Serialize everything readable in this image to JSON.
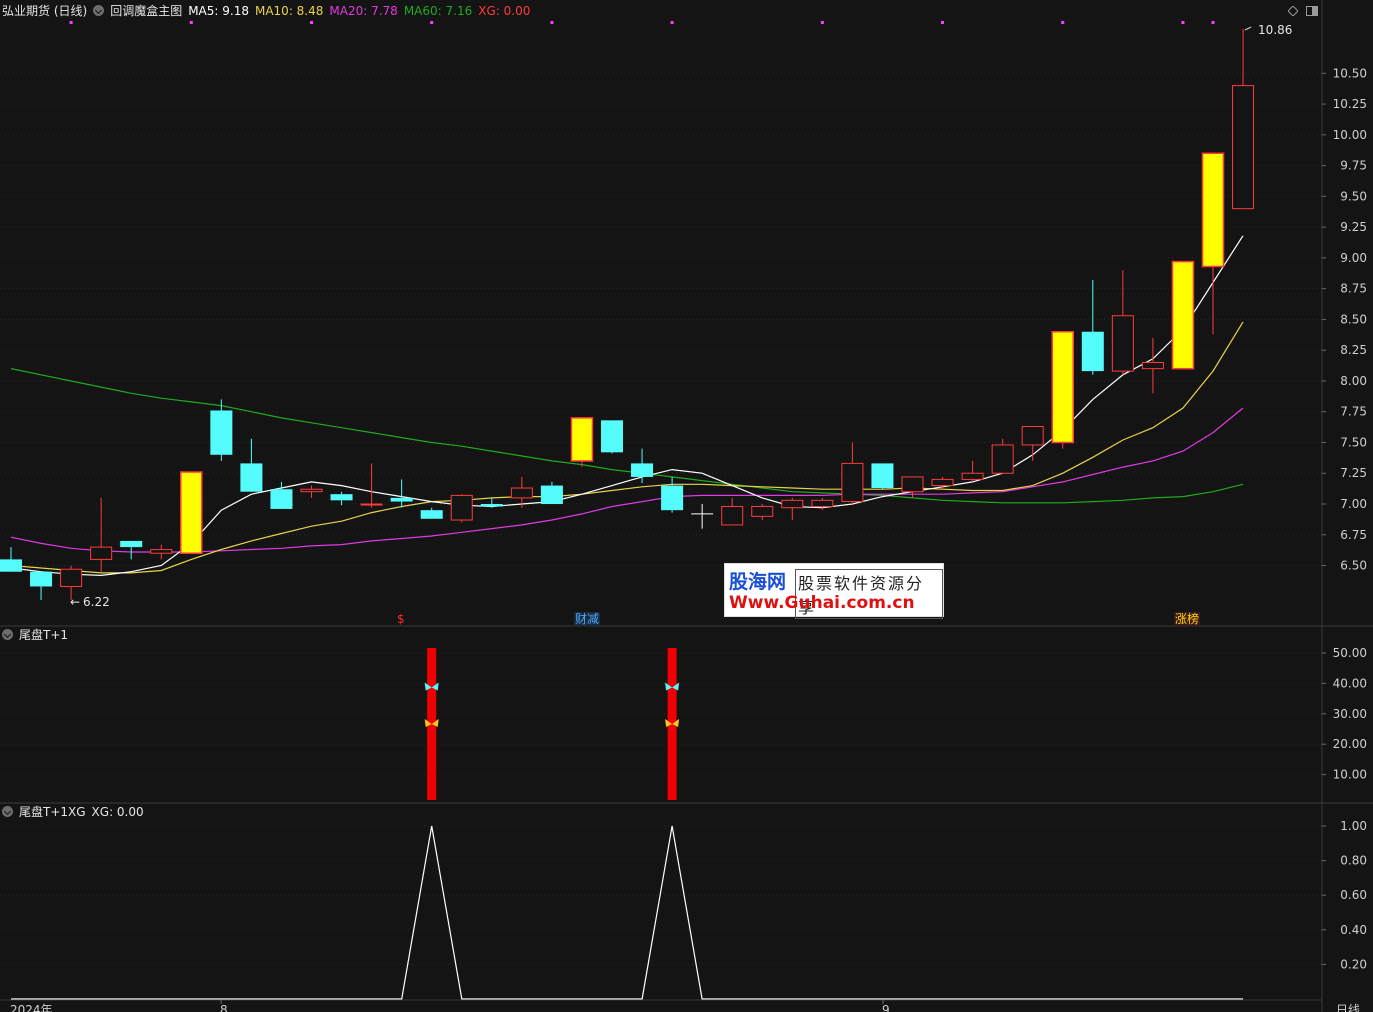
{
  "header": {
    "stock": "弘业期货 (日线)",
    "indicator": "回调魔盒主图",
    "ma5": "MA5: 9.18",
    "ma10": "MA10: 8.48",
    "ma20": "MA20: 7.78",
    "ma60": "MA60: 7.16",
    "xg": "XG: 0.00"
  },
  "panel2": {
    "title": "尾盘T+1"
  },
  "panel3": {
    "title": "尾盘T+1XG",
    "xg": "XG: 0.00"
  },
  "labels": {
    "high": "10.86",
    "low": "6.22",
    "year": "2024年",
    "m8": "8",
    "m9": "9",
    "period": "日线"
  },
  "badges": [
    {
      "text": "$",
      "color": "#ff2a2a"
    },
    {
      "text": "财减",
      "color": "#4aa8ff"
    },
    {
      "text": "涨榜",
      "color": "#ffd700"
    }
  ],
  "watermark": {
    "brand": "股海网",
    "slogan": "股票软件资源分享",
    "url": "Www.Guhai.com.cn"
  },
  "colors": {
    "up": "#ff3b3b",
    "down": "#54fcfc",
    "signal": "#ffff00",
    "ma5": "#ffffff",
    "ma10": "#e8d34a",
    "ma20": "#e03ae0",
    "ma60": "#1faa1f",
    "bar": "#ee0000",
    "xg": "#ff3bff"
  },
  "chart_data": [
    {
      "type": "candlestick",
      "title": "回调魔盒主图",
      "ylim": [
        6.22,
        10.86
      ],
      "yticks": [
        6.5,
        6.75,
        7.0,
        7.25,
        7.5,
        7.75,
        8.0,
        8.25,
        8.5,
        8.75,
        9.0,
        9.25,
        9.5,
        9.75,
        10.0,
        10.25,
        10.5
      ],
      "candles": [
        {
          "o": 6.55,
          "h": 6.65,
          "l": 6.45,
          "c": 6.45,
          "s": "down"
        },
        {
          "o": 6.45,
          "h": 6.45,
          "l": 6.22,
          "c": 6.33,
          "s": "down"
        },
        {
          "o": 6.33,
          "h": 6.5,
          "l": 6.22,
          "c": 6.47,
          "s": "up"
        },
        {
          "o": 6.55,
          "h": 7.05,
          "l": 6.45,
          "c": 6.65,
          "s": "up"
        },
        {
          "o": 6.65,
          "h": 6.7,
          "l": 6.55,
          "c": 6.7,
          "s": "down"
        },
        {
          "o": 6.6,
          "h": 6.67,
          "l": 6.55,
          "c": 6.63,
          "s": "up"
        },
        {
          "o": 6.6,
          "h": 7.26,
          "l": 6.6,
          "c": 7.26,
          "s": "signal"
        },
        {
          "o": 7.76,
          "h": 7.85,
          "l": 7.35,
          "c": 7.4,
          "s": "down"
        },
        {
          "o": 7.33,
          "h": 7.53,
          "l": 7.1,
          "c": 7.1,
          "s": "down"
        },
        {
          "o": 7.12,
          "h": 7.18,
          "l": 6.97,
          "c": 6.96,
          "s": "down"
        },
        {
          "o": 7.1,
          "h": 7.15,
          "l": 7.05,
          "c": 7.12,
          "s": "up"
        },
        {
          "o": 7.08,
          "h": 7.1,
          "l": 6.99,
          "c": 7.03,
          "s": "down"
        },
        {
          "o": 7.0,
          "h": 7.33,
          "l": 6.97,
          "c": 7.0,
          "s": "up"
        },
        {
          "o": 7.05,
          "h": 7.2,
          "l": 6.97,
          "c": 7.02,
          "s": "down"
        },
        {
          "o": 6.95,
          "h": 6.97,
          "l": 6.88,
          "c": 6.88,
          "s": "down"
        },
        {
          "o": 6.87,
          "h": 7.08,
          "l": 6.85,
          "c": 7.07,
          "s": "up"
        },
        {
          "o": 7.0,
          "h": 7.05,
          "l": 6.97,
          "c": 6.98,
          "s": "down"
        },
        {
          "o": 7.05,
          "h": 7.22,
          "l": 6.97,
          "c": 7.13,
          "s": "up"
        },
        {
          "o": 7.15,
          "h": 7.18,
          "l": 7.0,
          "c": 7.0,
          "s": "down"
        },
        {
          "o": 7.35,
          "h": 7.7,
          "l": 7.3,
          "c": 7.7,
          "s": "signal"
        },
        {
          "o": 7.68,
          "h": 7.68,
          "l": 7.41,
          "c": 7.42,
          "s": "down"
        },
        {
          "o": 7.33,
          "h": 7.45,
          "l": 7.17,
          "c": 7.22,
          "s": "down"
        },
        {
          "o": 7.15,
          "h": 7.22,
          "l": 6.93,
          "c": 6.95,
          "s": "down"
        },
        {
          "o": 6.9,
          "h": 7.0,
          "l": 6.8,
          "c": 6.92,
          "s": "cross"
        },
        {
          "o": 6.83,
          "h": 7.05,
          "l": 6.83,
          "c": 6.98,
          "s": "up"
        },
        {
          "o": 6.9,
          "h": 7.0,
          "l": 6.87,
          "c": 6.98,
          "s": "up"
        },
        {
          "o": 6.97,
          "h": 7.05,
          "l": 6.87,
          "c": 7.03,
          "s": "up"
        },
        {
          "o": 6.98,
          "h": 7.05,
          "l": 6.95,
          "c": 7.03,
          "s": "up"
        },
        {
          "o": 7.02,
          "h": 7.5,
          "l": 7.0,
          "c": 7.33,
          "s": "up"
        },
        {
          "o": 7.33,
          "h": 7.33,
          "l": 7.12,
          "c": 7.13,
          "s": "down"
        },
        {
          "o": 7.1,
          "h": 7.22,
          "l": 7.05,
          "c": 7.22,
          "s": "up"
        },
        {
          "o": 7.15,
          "h": 7.22,
          "l": 7.12,
          "c": 7.2,
          "s": "up"
        },
        {
          "o": 7.2,
          "h": 7.35,
          "l": 7.18,
          "c": 7.25,
          "s": "up"
        },
        {
          "o": 7.25,
          "h": 7.53,
          "l": 7.25,
          "c": 7.48,
          "s": "up"
        },
        {
          "o": 7.48,
          "h": 7.58,
          "l": 7.35,
          "c": 7.63,
          "s": "up"
        },
        {
          "o": 7.5,
          "h": 8.4,
          "l": 7.45,
          "c": 8.4,
          "s": "signal"
        },
        {
          "o": 8.4,
          "h": 8.82,
          "l": 8.05,
          "c": 8.08,
          "s": "down"
        },
        {
          "o": 8.08,
          "h": 8.9,
          "l": 8.05,
          "c": 8.53,
          "s": "up"
        },
        {
          "o": 8.1,
          "h": 8.35,
          "l": 7.9,
          "c": 8.15,
          "s": "up"
        },
        {
          "o": 8.1,
          "h": 8.97,
          "l": 8.1,
          "c": 8.97,
          "s": "signal"
        },
        {
          "o": 8.93,
          "h": 9.85,
          "l": 8.38,
          "c": 9.85,
          "s": "signal"
        },
        {
          "o": 9.4,
          "h": 10.86,
          "l": 9.4,
          "c": 10.4,
          "s": "up"
        }
      ],
      "ma5": [
        6.48,
        6.45,
        6.43,
        6.42,
        6.45,
        6.5,
        6.68,
        6.95,
        7.08,
        7.13,
        7.18,
        7.15,
        7.1,
        7.06,
        7.02,
        6.99,
        6.98,
        7.0,
        7.02,
        7.08,
        7.15,
        7.22,
        7.28,
        7.25,
        7.15,
        7.05,
        6.98,
        6.97,
        7.0,
        7.06,
        7.1,
        7.14,
        7.18,
        7.25,
        7.4,
        7.6,
        7.85,
        8.05,
        8.18,
        8.42,
        8.8,
        9.18
      ],
      "ma10": [
        6.5,
        6.48,
        6.46,
        6.44,
        6.44,
        6.46,
        6.55,
        6.63,
        6.7,
        6.76,
        6.82,
        6.86,
        6.93,
        6.98,
        7.02,
        7.03,
        7.05,
        7.06,
        7.06,
        7.08,
        7.11,
        7.14,
        7.16,
        7.16,
        7.15,
        7.14,
        7.13,
        7.12,
        7.12,
        7.12,
        7.13,
        7.12,
        7.11,
        7.11,
        7.15,
        7.25,
        7.38,
        7.52,
        7.62,
        7.78,
        8.08,
        8.48
      ],
      "ma20": [
        6.73,
        6.68,
        6.64,
        6.62,
        6.61,
        6.61,
        6.61,
        6.62,
        6.63,
        6.64,
        6.66,
        6.67,
        6.7,
        6.72,
        6.74,
        6.77,
        6.8,
        6.83,
        6.87,
        6.92,
        6.98,
        7.02,
        7.06,
        7.07,
        7.07,
        7.07,
        7.07,
        7.07,
        7.08,
        7.08,
        7.08,
        7.08,
        7.09,
        7.1,
        7.14,
        7.18,
        7.24,
        7.3,
        7.35,
        7.43,
        7.58,
        7.78
      ],
      "ma60": [
        8.1,
        8.05,
        8.0,
        7.95,
        7.9,
        7.86,
        7.83,
        7.8,
        7.75,
        7.7,
        7.66,
        7.62,
        7.58,
        7.54,
        7.5,
        7.47,
        7.43,
        7.39,
        7.35,
        7.32,
        7.28,
        7.25,
        7.22,
        7.19,
        7.16,
        7.13,
        7.1,
        7.09,
        7.08,
        7.07,
        7.05,
        7.03,
        7.02,
        7.01,
        7.01,
        7.01,
        7.02,
        7.03,
        7.05,
        7.06,
        7.1,
        7.16
      ],
      "xg_markers": [
        2,
        6,
        10,
        14,
        18,
        22,
        27,
        31,
        35,
        39,
        40
      ]
    },
    {
      "type": "bar",
      "title": "尾盘T+1",
      "ylim": [
        0,
        53
      ],
      "yticks": [
        10.0,
        20.0,
        30.0,
        40.0,
        50.0
      ],
      "bars": [
        {
          "index": 14,
          "value": 50
        },
        {
          "index": 22,
          "value": 50
        }
      ],
      "markers": [
        {
          "index": 14,
          "value": 37,
          "color": "#54fcfc"
        },
        {
          "index": 14,
          "value": 25,
          "color": "#ffc820"
        },
        {
          "index": 22,
          "value": 37,
          "color": "#54fcfc"
        },
        {
          "index": 22,
          "value": 25,
          "color": "#ffc820"
        }
      ]
    },
    {
      "type": "line",
      "title": "尾盘T+1XG",
      "ylim": [
        0,
        1.05
      ],
      "yticks": [
        0.2,
        0.4,
        0.6,
        0.8,
        1.0
      ],
      "values": [
        0,
        0,
        0,
        0,
        0,
        0,
        0,
        0,
        0,
        0,
        0,
        0,
        0,
        0,
        1,
        0,
        0,
        0,
        0,
        0,
        0,
        0,
        1,
        0,
        0,
        0,
        0,
        0,
        0,
        0,
        0,
        0,
        0,
        0,
        0,
        0,
        0,
        0,
        0,
        0,
        0,
        0
      ]
    }
  ]
}
